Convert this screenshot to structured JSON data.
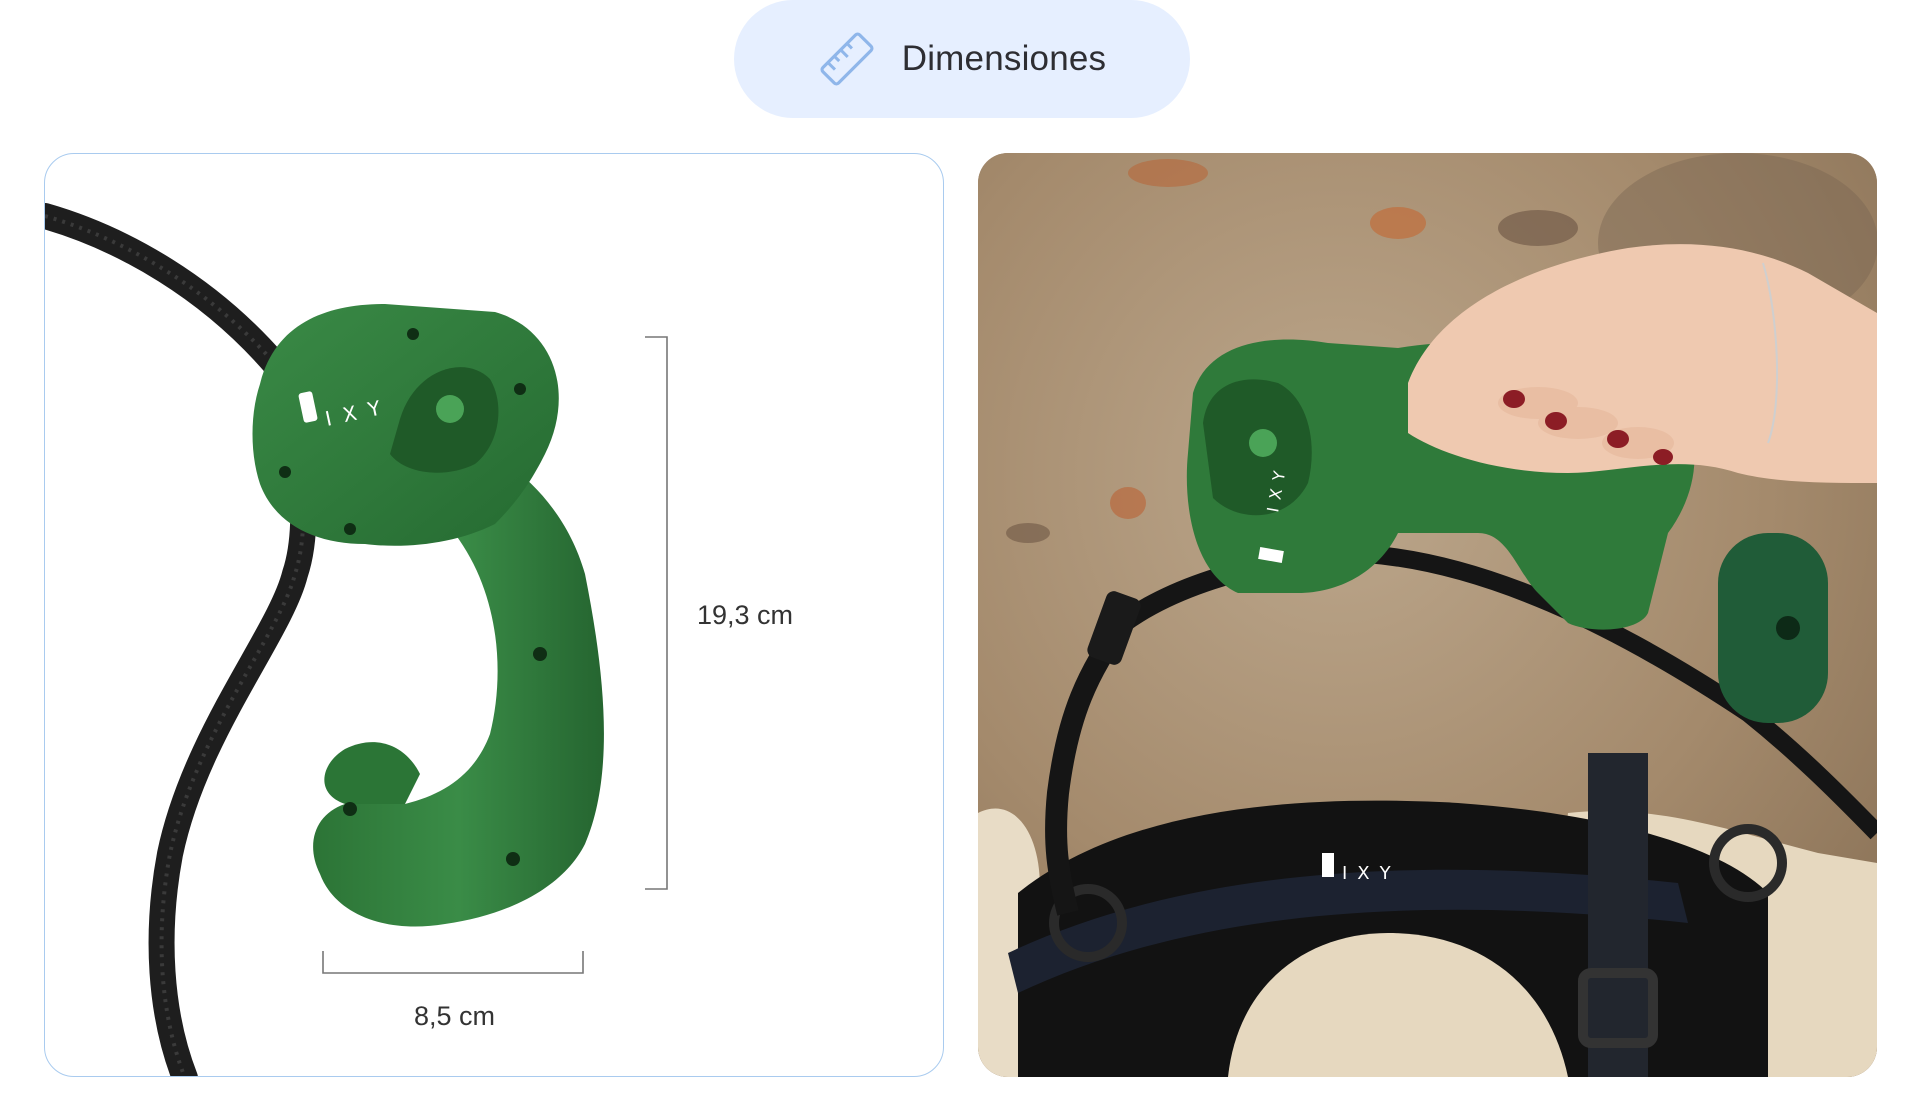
{
  "tab": {
    "label": "Dimensiones",
    "icon": "ruler-icon",
    "bg_color": "#e6efff",
    "icon_color": "#8fb6ea"
  },
  "product_image": {
    "brand": "FIXY",
    "dimension_height": "19,3 cm",
    "dimension_width": "8,5 cm",
    "product_color": "#2f7a3a",
    "border_color": "#a9cbef"
  },
  "lifestyle_image": {
    "brand": "FIXY"
  }
}
